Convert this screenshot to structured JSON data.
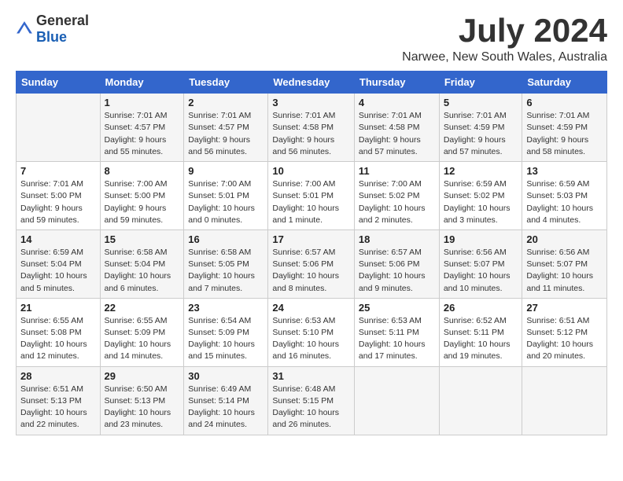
{
  "header": {
    "logo": {
      "text_general": "General",
      "text_blue": "Blue"
    },
    "title": "July 2024",
    "subtitle": "Narwee, New South Wales, Australia"
  },
  "calendar": {
    "weekdays": [
      "Sunday",
      "Monday",
      "Tuesday",
      "Wednesday",
      "Thursday",
      "Friday",
      "Saturday"
    ],
    "weeks": [
      [
        {
          "day": "",
          "info": ""
        },
        {
          "day": "1",
          "info": "Sunrise: 7:01 AM\nSunset: 4:57 PM\nDaylight: 9 hours\nand 55 minutes."
        },
        {
          "day": "2",
          "info": "Sunrise: 7:01 AM\nSunset: 4:57 PM\nDaylight: 9 hours\nand 56 minutes."
        },
        {
          "day": "3",
          "info": "Sunrise: 7:01 AM\nSunset: 4:58 PM\nDaylight: 9 hours\nand 56 minutes."
        },
        {
          "day": "4",
          "info": "Sunrise: 7:01 AM\nSunset: 4:58 PM\nDaylight: 9 hours\nand 57 minutes."
        },
        {
          "day": "5",
          "info": "Sunrise: 7:01 AM\nSunset: 4:59 PM\nDaylight: 9 hours\nand 57 minutes."
        },
        {
          "day": "6",
          "info": "Sunrise: 7:01 AM\nSunset: 4:59 PM\nDaylight: 9 hours\nand 58 minutes."
        }
      ],
      [
        {
          "day": "7",
          "info": "Sunrise: 7:01 AM\nSunset: 5:00 PM\nDaylight: 9 hours\nand 59 minutes."
        },
        {
          "day": "8",
          "info": "Sunrise: 7:00 AM\nSunset: 5:00 PM\nDaylight: 9 hours\nand 59 minutes."
        },
        {
          "day": "9",
          "info": "Sunrise: 7:00 AM\nSunset: 5:01 PM\nDaylight: 10 hours\nand 0 minutes."
        },
        {
          "day": "10",
          "info": "Sunrise: 7:00 AM\nSunset: 5:01 PM\nDaylight: 10 hours\nand 1 minute."
        },
        {
          "day": "11",
          "info": "Sunrise: 7:00 AM\nSunset: 5:02 PM\nDaylight: 10 hours\nand 2 minutes."
        },
        {
          "day": "12",
          "info": "Sunrise: 6:59 AM\nSunset: 5:02 PM\nDaylight: 10 hours\nand 3 minutes."
        },
        {
          "day": "13",
          "info": "Sunrise: 6:59 AM\nSunset: 5:03 PM\nDaylight: 10 hours\nand 4 minutes."
        }
      ],
      [
        {
          "day": "14",
          "info": "Sunrise: 6:59 AM\nSunset: 5:04 PM\nDaylight: 10 hours\nand 5 minutes."
        },
        {
          "day": "15",
          "info": "Sunrise: 6:58 AM\nSunset: 5:04 PM\nDaylight: 10 hours\nand 6 minutes."
        },
        {
          "day": "16",
          "info": "Sunrise: 6:58 AM\nSunset: 5:05 PM\nDaylight: 10 hours\nand 7 minutes."
        },
        {
          "day": "17",
          "info": "Sunrise: 6:57 AM\nSunset: 5:06 PM\nDaylight: 10 hours\nand 8 minutes."
        },
        {
          "day": "18",
          "info": "Sunrise: 6:57 AM\nSunset: 5:06 PM\nDaylight: 10 hours\nand 9 minutes."
        },
        {
          "day": "19",
          "info": "Sunrise: 6:56 AM\nSunset: 5:07 PM\nDaylight: 10 hours\nand 10 minutes."
        },
        {
          "day": "20",
          "info": "Sunrise: 6:56 AM\nSunset: 5:07 PM\nDaylight: 10 hours\nand 11 minutes."
        }
      ],
      [
        {
          "day": "21",
          "info": "Sunrise: 6:55 AM\nSunset: 5:08 PM\nDaylight: 10 hours\nand 12 minutes."
        },
        {
          "day": "22",
          "info": "Sunrise: 6:55 AM\nSunset: 5:09 PM\nDaylight: 10 hours\nand 14 minutes."
        },
        {
          "day": "23",
          "info": "Sunrise: 6:54 AM\nSunset: 5:09 PM\nDaylight: 10 hours\nand 15 minutes."
        },
        {
          "day": "24",
          "info": "Sunrise: 6:53 AM\nSunset: 5:10 PM\nDaylight: 10 hours\nand 16 minutes."
        },
        {
          "day": "25",
          "info": "Sunrise: 6:53 AM\nSunset: 5:11 PM\nDaylight: 10 hours\nand 17 minutes."
        },
        {
          "day": "26",
          "info": "Sunrise: 6:52 AM\nSunset: 5:11 PM\nDaylight: 10 hours\nand 19 minutes."
        },
        {
          "day": "27",
          "info": "Sunrise: 6:51 AM\nSunset: 5:12 PM\nDaylight: 10 hours\nand 20 minutes."
        }
      ],
      [
        {
          "day": "28",
          "info": "Sunrise: 6:51 AM\nSunset: 5:13 PM\nDaylight: 10 hours\nand 22 minutes."
        },
        {
          "day": "29",
          "info": "Sunrise: 6:50 AM\nSunset: 5:13 PM\nDaylight: 10 hours\nand 23 minutes."
        },
        {
          "day": "30",
          "info": "Sunrise: 6:49 AM\nSunset: 5:14 PM\nDaylight: 10 hours\nand 24 minutes."
        },
        {
          "day": "31",
          "info": "Sunrise: 6:48 AM\nSunset: 5:15 PM\nDaylight: 10 hours\nand 26 minutes."
        },
        {
          "day": "",
          "info": ""
        },
        {
          "day": "",
          "info": ""
        },
        {
          "day": "",
          "info": ""
        }
      ]
    ]
  }
}
